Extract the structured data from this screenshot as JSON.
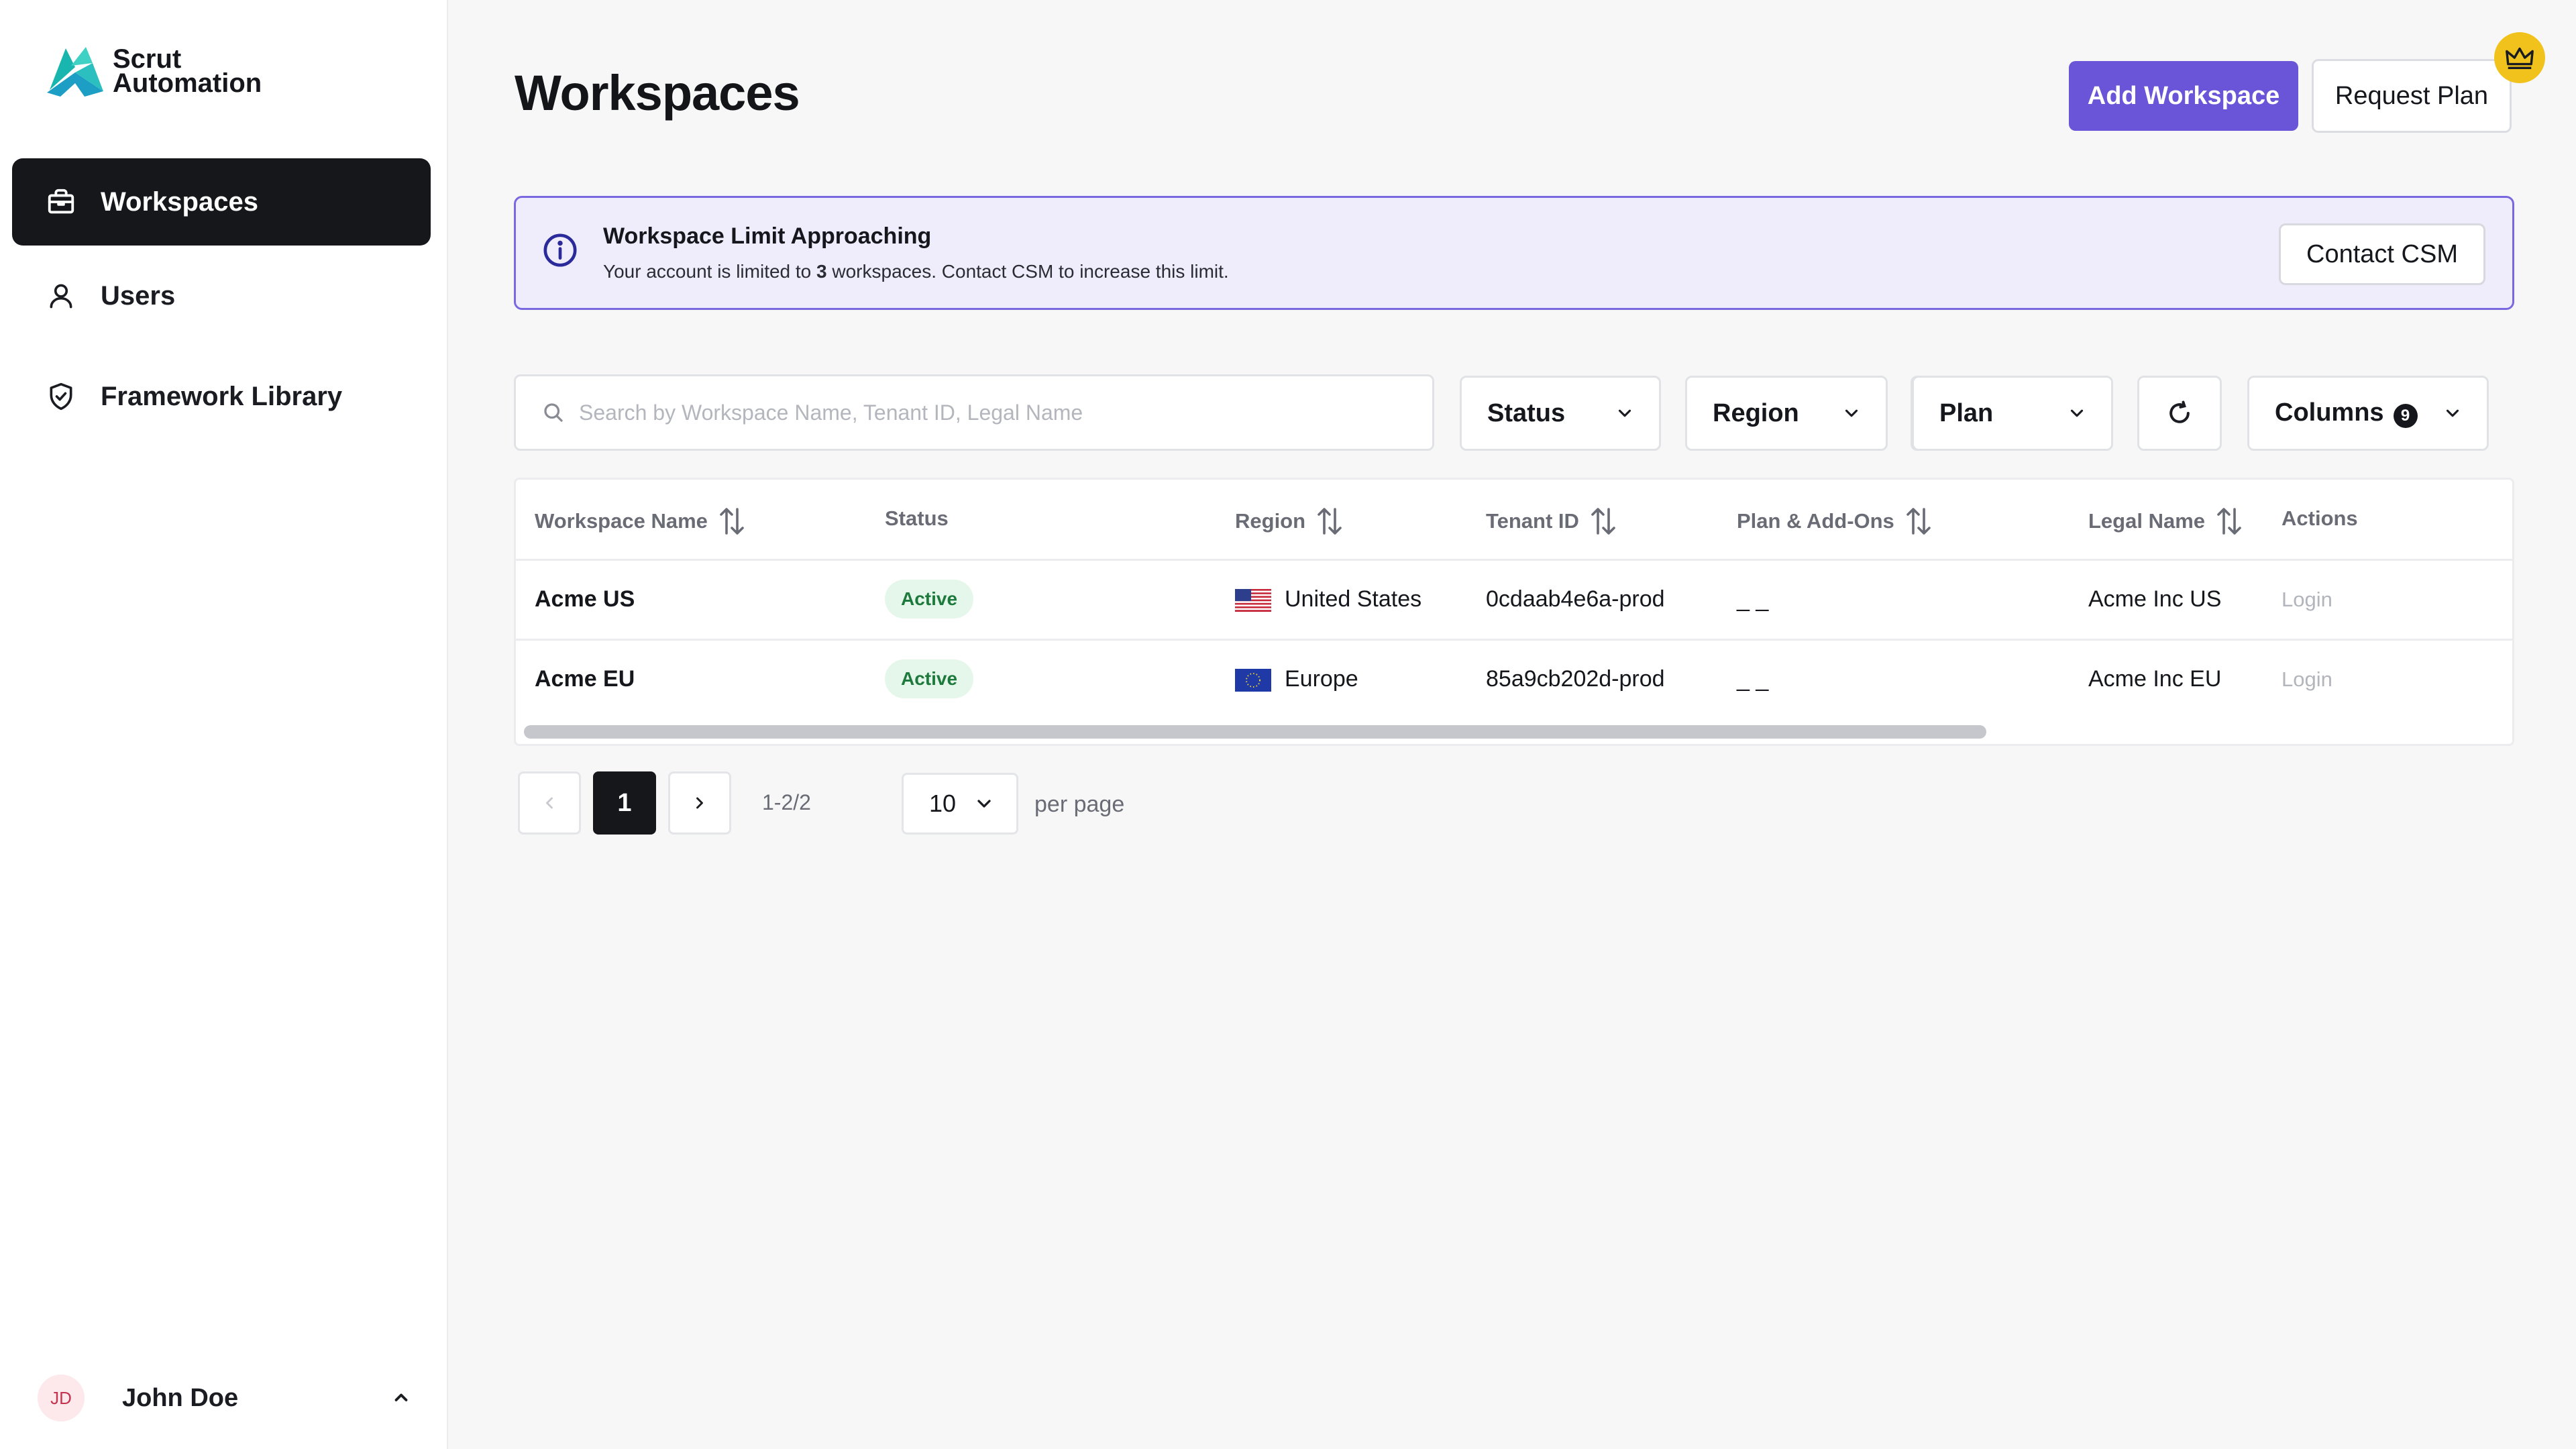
{
  "brand": {
    "line1": "Scrut",
    "line2": "Automation"
  },
  "sidebar": {
    "items": [
      {
        "label": "Workspaces",
        "icon": "briefcase-icon",
        "active": true
      },
      {
        "label": "Users",
        "icon": "user-icon",
        "active": false
      },
      {
        "label": "Framework Library",
        "icon": "shield-check-icon",
        "active": false
      }
    ],
    "user": {
      "initials": "JD",
      "name": "John Doe"
    }
  },
  "header": {
    "title": "Workspaces",
    "add_label": "Add Workspace",
    "request_label": "Request Plan"
  },
  "alert": {
    "title": "Workspace Limit Approaching",
    "body_prefix": "Your account is limited to ",
    "limit": "3",
    "body_suffix": " workspaces. Contact CSM to increase this limit.",
    "action_label": "Contact CSM"
  },
  "filters": {
    "search_placeholder": "Search by Workspace Name, Tenant ID, Legal Name",
    "status_label": "Status",
    "region_label": "Region",
    "plan_label": "Plan",
    "columns_label": "Columns",
    "columns_count": "9"
  },
  "table": {
    "headers": [
      "Workspace Name",
      "Status",
      "Region",
      "Tenant ID",
      "Plan & Add-Ons",
      "Legal Name",
      "Actions"
    ],
    "rows": [
      {
        "name": "Acme US",
        "status": "Active",
        "region": "United States",
        "flag": "us-flag",
        "tenant": "0cdaab4e6a-prod",
        "plan": "_ _",
        "legal": "Acme Inc US",
        "action": "Login"
      },
      {
        "name": "Acme EU",
        "status": "Active",
        "region": "Europe",
        "flag": "eu-flag",
        "tenant": "85a9cb202d-prod",
        "plan": "_ _",
        "legal": "Acme Inc EU",
        "action": "Login"
      }
    ]
  },
  "pagination": {
    "current": "1",
    "range": "1-2/2",
    "per_page": "10",
    "per_page_label": "per page"
  },
  "colors": {
    "accent": "#6a55d8",
    "alert_bg": "#efecfc",
    "active_nav": "#15171b",
    "status_green": "#1d7a3c",
    "crown": "#f1c21b"
  }
}
